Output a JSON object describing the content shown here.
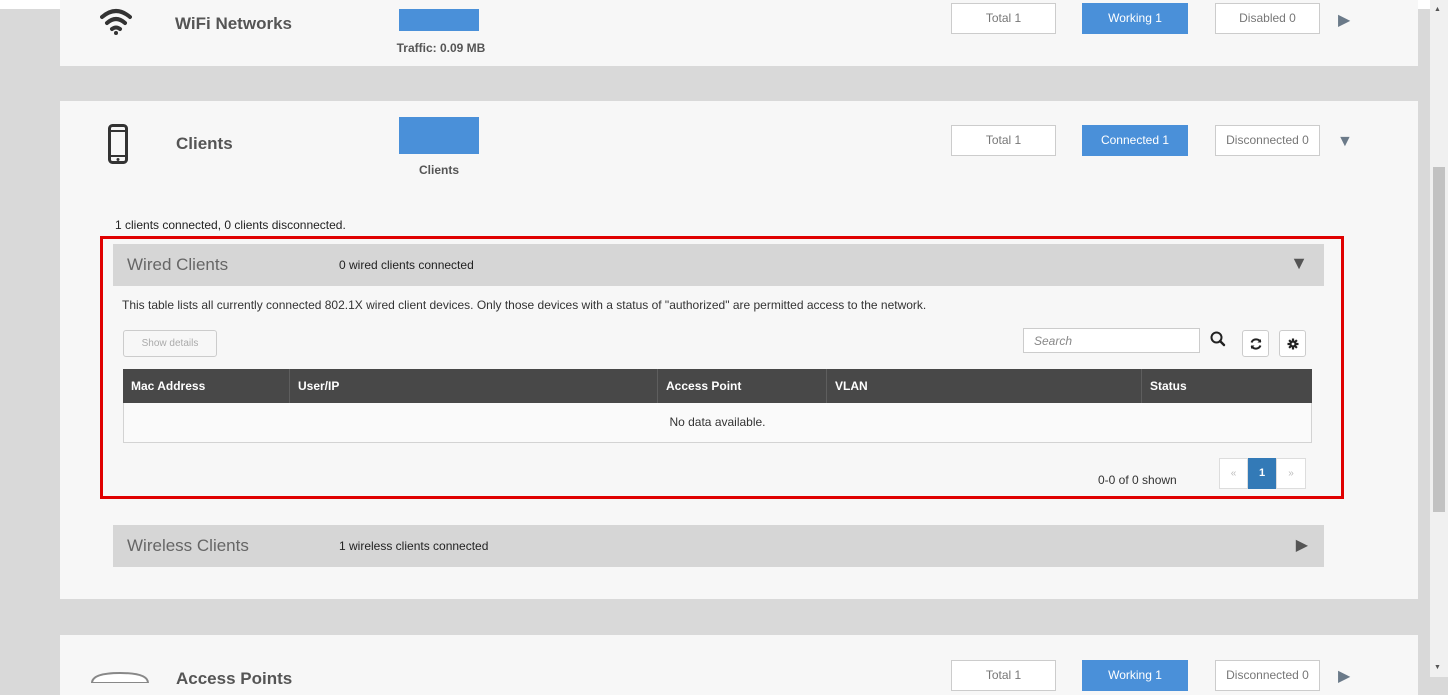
{
  "wifi": {
    "title": "WiFi Networks",
    "bar_caption": "Traffic: 0.09 MB",
    "stats": {
      "total": "Total 1",
      "working": "Working 1",
      "disabled": "Disabled 0"
    }
  },
  "clients": {
    "title": "Clients",
    "bar_caption": "Clients",
    "stats": {
      "total": "Total 1",
      "connected": "Connected 1",
      "disconnected": "Disconnected 0"
    },
    "summary": "1 clients connected, 0 clients disconnected.",
    "wired": {
      "title": "Wired Clients",
      "info": "0 wired clients connected",
      "description": "This table lists all currently connected 802.1X wired client devices. Only those devices with a status of \"authorized\" are permitted access to the network.",
      "show_details_label": "Show details",
      "search_placeholder": "Search",
      "columns": [
        "Mac Address",
        "User/IP",
        "Access Point",
        "VLAN",
        "Status"
      ],
      "empty_message": "No data available.",
      "shown_text": "0-0 of 0 shown",
      "pager": {
        "prev": "«",
        "current": "1",
        "next": "»"
      }
    },
    "wireless": {
      "title": "Wireless Clients",
      "info": "1 wireless clients connected"
    }
  },
  "access_points": {
    "title": "Access Points",
    "stats": {
      "total": "Total 1",
      "working": "Working 1",
      "disconnected": "Disconnected 0"
    }
  },
  "colors": {
    "accent": "#4a90d9",
    "highlight": "#e00000",
    "table_header": "#484848"
  }
}
